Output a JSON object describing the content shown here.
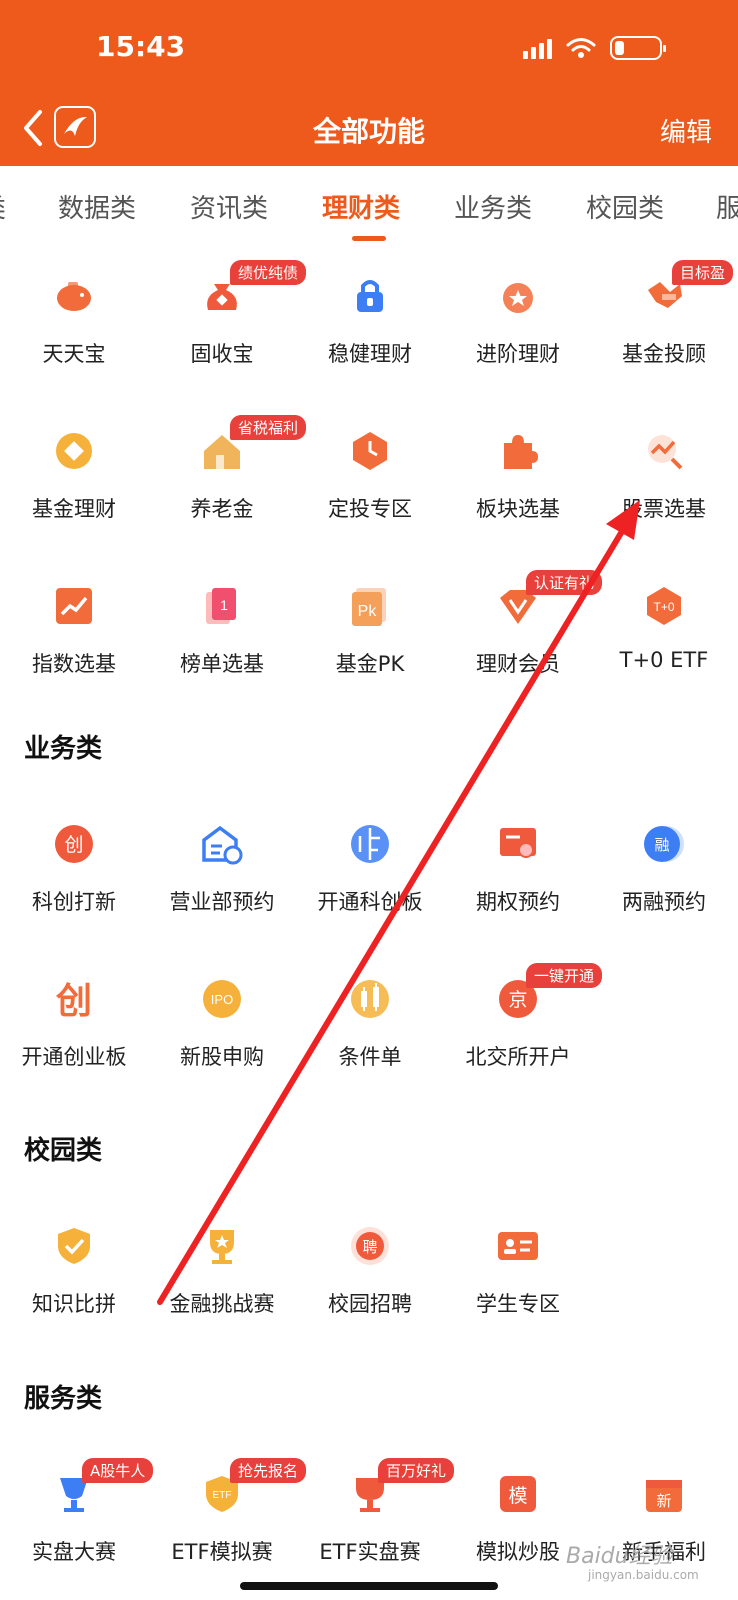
{
  "status": {
    "time": "15:43"
  },
  "header": {
    "title": "全部功能",
    "edit": "编辑"
  },
  "tabs": [
    {
      "label": "类"
    },
    {
      "label": "数据类"
    },
    {
      "label": "资讯类"
    },
    {
      "label": "理财类",
      "active": true
    },
    {
      "label": "业务类"
    },
    {
      "label": "校园类"
    },
    {
      "label": "服"
    }
  ],
  "licai": [
    {
      "label": "天天宝",
      "icon": "piggy-bank-icon",
      "color": "#f26b3a"
    },
    {
      "label": "固收宝",
      "icon": "money-bag-icon",
      "color": "#f05a3c",
      "badge": "绩优纯债"
    },
    {
      "label": "稳健理财",
      "icon": "lock-icon",
      "color": "#3d7ef5"
    },
    {
      "label": "进阶理财",
      "icon": "medal-icon",
      "color": "#f26b3a"
    },
    {
      "label": "基金投顾",
      "icon": "handshake-icon",
      "color": "#f26b3a",
      "badge": "目标盈"
    },
    {
      "label": "基金理财",
      "icon": "coin-icon",
      "color": "#f5b13a"
    },
    {
      "label": "养老金",
      "icon": "house-icon",
      "color": "#f0b45a",
      "badge": "省税福利"
    },
    {
      "label": "定投专区",
      "icon": "clock-icon",
      "color": "#f26b3a"
    },
    {
      "label": "板块选基",
      "icon": "puzzle-icon",
      "color": "#f26b3a"
    },
    {
      "label": "股票选基",
      "icon": "stock-search-icon",
      "color": "#f26b3a"
    },
    {
      "label": "指数选基",
      "icon": "trend-chart-icon",
      "color": "#f26b3a"
    },
    {
      "label": "榜单选基",
      "icon": "ranking-icon",
      "color": "#f0506e"
    },
    {
      "label": "基金PK",
      "icon": "pk-icon",
      "color": "#f5a05a"
    },
    {
      "label": "理财会员",
      "icon": "vip-icon",
      "color": "#f26b3a",
      "badge": "认证有礼"
    },
    {
      "label": "T+0 ETF",
      "icon": "t0-hexagon-icon",
      "color": "#f26b3a"
    }
  ],
  "yewu": {
    "title": "业务类",
    "items": [
      {
        "label": "科创打新",
        "icon": "chuang-circle-icon",
        "color": "#f05a3c"
      },
      {
        "label": "营业部预约",
        "icon": "building-clock-icon",
        "color": "#3d7ef5"
      },
      {
        "label": "开通科创板",
        "icon": "circuit-icon",
        "color": "#3d7ef5"
      },
      {
        "label": "期权预约",
        "icon": "certificate-icon",
        "color": "#f05a3c"
      },
      {
        "label": "两融预约",
        "icon": "rong-circle-icon",
        "color": "#3d7ef5"
      },
      {
        "label": "开通创业板",
        "icon": "chuang-text-icon",
        "color": "#f26b3a"
      },
      {
        "label": "新股申购",
        "icon": "ipo-icon",
        "color": "#f5b13a"
      },
      {
        "label": "条件单",
        "icon": "candlestick-icon",
        "color": "#f5b13a"
      },
      {
        "label": "北交所开户",
        "icon": "jing-circle-icon",
        "color": "#f05a3c",
        "badge": "一键开通"
      }
    ]
  },
  "xiaoyuan": {
    "title": "校园类",
    "items": [
      {
        "label": "知识比拼",
        "icon": "shield-check-icon",
        "color": "#f5b13a"
      },
      {
        "label": "金融挑战赛",
        "icon": "trophy-icon",
        "color": "#f5b13a"
      },
      {
        "label": "校园招聘",
        "icon": "pin-icon",
        "color": "#f05a3c"
      },
      {
        "label": "学生专区",
        "icon": "id-card-icon",
        "color": "#f26b3a"
      }
    ]
  },
  "fuwu": {
    "title": "服务类",
    "items": [
      {
        "label": "实盘大赛",
        "icon": "cup-icon",
        "color": "#3d7ef5",
        "badge": "A股牛人"
      },
      {
        "label": "ETF模拟赛",
        "icon": "etf-badge-icon",
        "color": "#f5b13a",
        "badge": "抢先报名"
      },
      {
        "label": "ETF实盘赛",
        "icon": "gold-cup-icon",
        "color": "#f05a3c",
        "badge": "百万好礼"
      },
      {
        "label": "模拟炒股",
        "icon": "mo-square-icon",
        "color": "#f05a3c"
      },
      {
        "label": "新手福利",
        "icon": "calendar-gift-icon",
        "color": "#f26b3a"
      }
    ]
  },
  "watermark": {
    "main": "Baidu经验",
    "sub": "jingyan.baidu.com"
  }
}
